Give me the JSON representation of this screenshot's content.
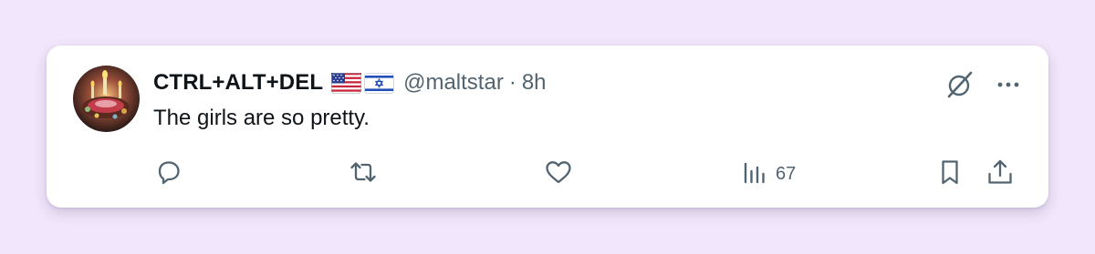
{
  "tweet": {
    "author_name": "CTRL+ALT+DEL",
    "flags": [
      "us-flag-icon",
      "israel-flag-icon"
    ],
    "handle": "@maltstar",
    "separator": "·",
    "time": "8h",
    "text": "The girls are so pretty.",
    "views": "67"
  },
  "colors": {
    "page_bg": "#f1e6fb",
    "card_bg": "#ffffff",
    "text_primary": "#0f1419",
    "text_secondary": "#536471"
  },
  "icons": {
    "top": [
      "grok-icon",
      "more-icon"
    ],
    "actions": [
      "reply-icon",
      "retweet-icon",
      "like-icon",
      "views-icon",
      "bookmark-icon",
      "share-icon"
    ]
  }
}
